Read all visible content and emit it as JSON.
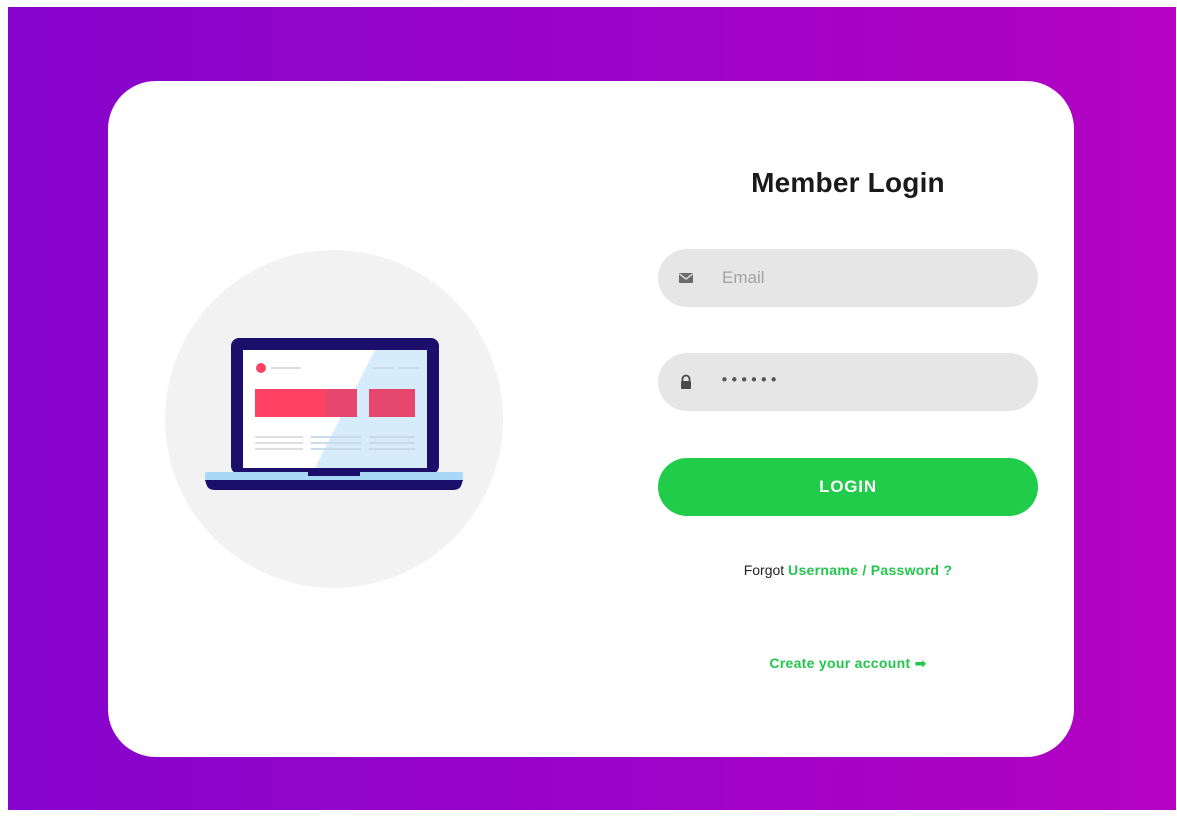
{
  "colors": {
    "background_gradient_start": "#8604cd",
    "background_gradient_end": "#b402c2",
    "card": "#ffffff",
    "input_background": "#e6e6e6",
    "accent_green": "#21cc4b",
    "illustration_circle": "#f2f2f2",
    "laptop_frame": "#1c0f6b",
    "laptop_screen_block": "#ff4264"
  },
  "form": {
    "title": "Member Login",
    "email": {
      "icon": "envelope-icon",
      "placeholder": "Email",
      "value": ""
    },
    "password": {
      "icon": "lock-icon",
      "value": "••••••"
    },
    "login_button_label": "LOGIN",
    "forgot": {
      "prefix": "Forgot",
      "link_label": "Username / Password ?"
    },
    "create_account": {
      "label": "Create your account",
      "icon": "arrow-right-icon",
      "arrow": "➡"
    }
  },
  "illustration": {
    "icon": "laptop-icon"
  }
}
